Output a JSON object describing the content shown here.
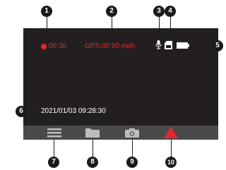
{
  "status": {
    "record_time": "00:30",
    "gps_text": "GPS:00 50 mph",
    "datetime": "2021/01/03 09:28:30"
  },
  "icons": {
    "record": "record-dot-icon",
    "microphone": "microphone-icon",
    "sd_card": "sd-card-icon",
    "battery": "battery-icon",
    "menu": "menu-icon",
    "folder": "folder-icon",
    "camera": "camera-icon",
    "emergency": "warning-triangle-icon"
  },
  "callouts": [
    "1",
    "2",
    "3",
    "4",
    "5",
    "6",
    "7",
    "8",
    "9",
    "10"
  ],
  "colors": {
    "screen_bg": "#231f20",
    "bottom_bar": "#4a4a4b",
    "accent_red": "#e8262c",
    "callout_bg": "#1a1a1a"
  }
}
